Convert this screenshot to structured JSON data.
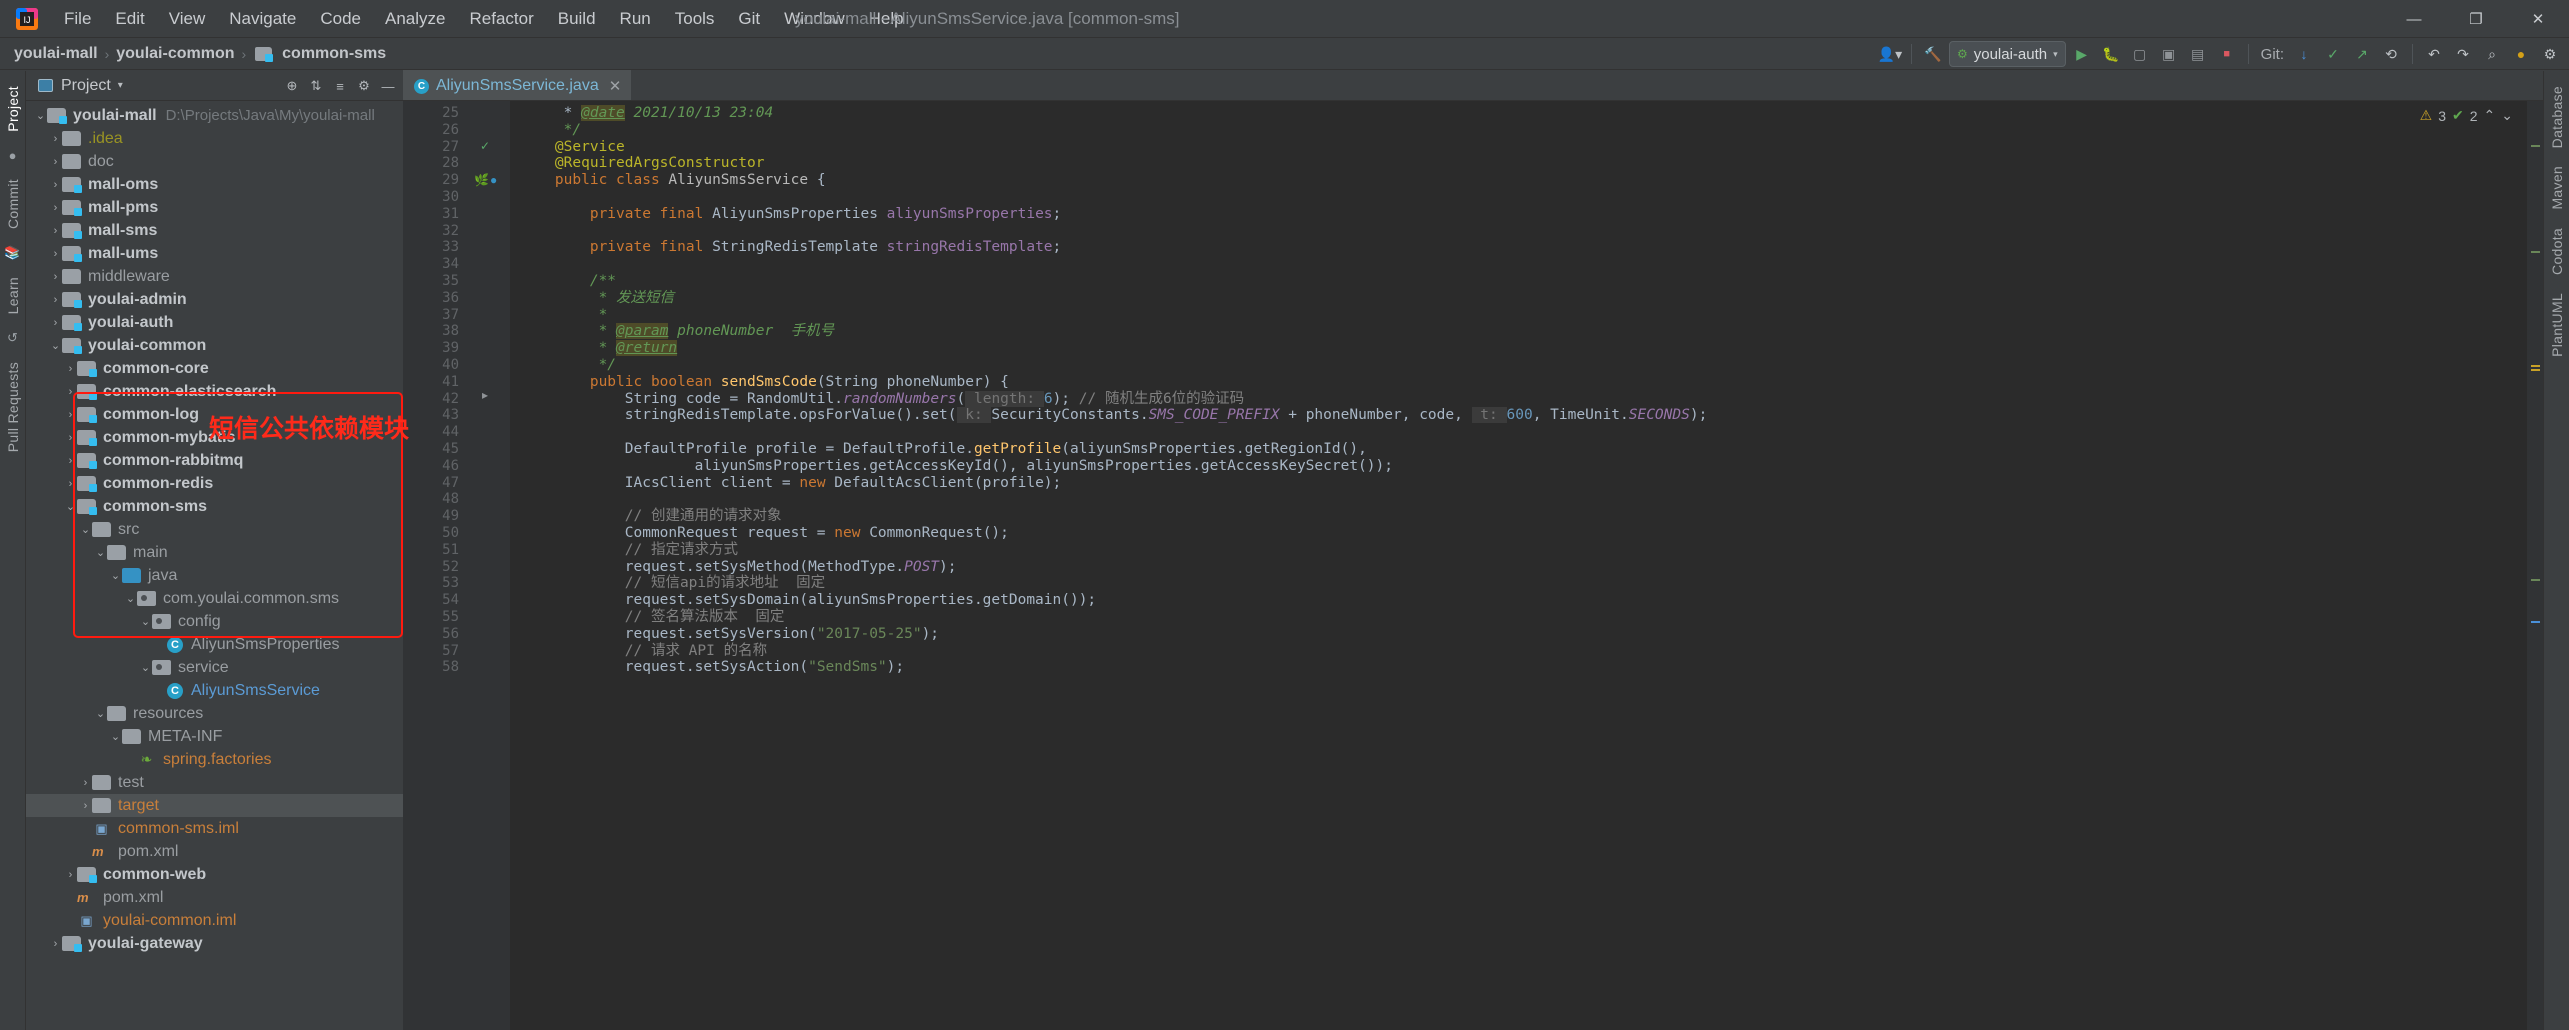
{
  "window": {
    "title": "youlai-mall - AliyunSmsService.java [common-sms]",
    "minimize": "—",
    "maximize": "❐",
    "close": "✕"
  },
  "menu": {
    "items": [
      "File",
      "Edit",
      "View",
      "Navigate",
      "Code",
      "Analyze",
      "Refactor",
      "Build",
      "Run",
      "Tools",
      "Git",
      "Window",
      "Help"
    ]
  },
  "breadcrumb": {
    "items": [
      "youlai-mall",
      "youlai-common",
      "common-sms"
    ],
    "separator": "›"
  },
  "toolbar": {
    "account_icon": "account-icon",
    "hammer_icon": "build-icon",
    "run_config": "youlai-auth",
    "run_icon": "▶",
    "debug_icon": "debug-icon",
    "coverage_icon": "coverage-icon",
    "profile_icon": "profile-icon",
    "stop_icon": "■",
    "git_label": "Git:",
    "git_update_icon": "↓",
    "git_commit_icon": "✓",
    "git_push_icon": "↗",
    "git_history_icon": "⟲",
    "undo_icon": "↶",
    "redo_icon": "↷",
    "search_icon": "⌕",
    "settings_icon": "⚙",
    "notification_icon": "notification-icon"
  },
  "left_rail": {
    "tabs": [
      "Project",
      "Commit",
      "Learn",
      "Pull Requests"
    ]
  },
  "right_rail": {
    "tabs": [
      "Database",
      "Maven",
      "Codota",
      "PlantUML"
    ]
  },
  "project_panel": {
    "title": "Project",
    "caret": "▾",
    "tools": [
      "⊕",
      "⇅",
      "≡",
      "⚙",
      "—"
    ]
  },
  "tree": [
    {
      "indent": 0,
      "arrow": "⌄",
      "icon": "folder-module",
      "label": "youlai-mall",
      "style": "mod",
      "path": "D:\\Projects\\Java\\My\\youlai-mall"
    },
    {
      "indent": 1,
      "arrow": "›",
      "icon": "folder",
      "label": ".idea",
      "style": "yellow"
    },
    {
      "indent": 1,
      "arrow": "›",
      "icon": "folder",
      "label": "doc",
      "style": "dim"
    },
    {
      "indent": 1,
      "arrow": "›",
      "icon": "folder-module",
      "label": "mall-oms",
      "style": "mod"
    },
    {
      "indent": 1,
      "arrow": "›",
      "icon": "folder-module",
      "label": "mall-pms",
      "style": "mod"
    },
    {
      "indent": 1,
      "arrow": "›",
      "icon": "folder-module",
      "label": "mall-sms",
      "style": "mod"
    },
    {
      "indent": 1,
      "arrow": "›",
      "icon": "folder-module",
      "label": "mall-ums",
      "style": "mod"
    },
    {
      "indent": 1,
      "arrow": "›",
      "icon": "folder",
      "label": "middleware",
      "style": "dim"
    },
    {
      "indent": 1,
      "arrow": "›",
      "icon": "folder-module",
      "label": "youlai-admin",
      "style": "mod"
    },
    {
      "indent": 1,
      "arrow": "›",
      "icon": "folder-module",
      "label": "youlai-auth",
      "style": "mod"
    },
    {
      "indent": 1,
      "arrow": "⌄",
      "icon": "folder-module",
      "label": "youlai-common",
      "style": "mod"
    },
    {
      "indent": 2,
      "arrow": "›",
      "icon": "folder-module",
      "label": "common-core",
      "style": "mod"
    },
    {
      "indent": 2,
      "arrow": "›",
      "icon": "folder-module",
      "label": "common-elasticsearch",
      "style": "mod"
    },
    {
      "indent": 2,
      "arrow": "›",
      "icon": "folder-module",
      "label": "common-log",
      "style": "mod"
    },
    {
      "indent": 2,
      "arrow": "›",
      "icon": "folder-module",
      "label": "common-mybatis",
      "style": "mod"
    },
    {
      "indent": 2,
      "arrow": "›",
      "icon": "folder-module",
      "label": "common-rabbitmq",
      "style": "mod"
    },
    {
      "indent": 2,
      "arrow": "›",
      "icon": "folder-module",
      "label": "common-redis",
      "style": "mod"
    },
    {
      "indent": 2,
      "arrow": "⌄",
      "icon": "folder-module",
      "label": "common-sms",
      "style": "mod"
    },
    {
      "indent": 3,
      "arrow": "⌄",
      "icon": "folder",
      "label": "src",
      "style": "dim"
    },
    {
      "indent": 4,
      "arrow": "⌄",
      "icon": "folder",
      "label": "main",
      "style": "dim"
    },
    {
      "indent": 5,
      "arrow": "⌄",
      "icon": "folder-src",
      "label": "java",
      "style": "dim"
    },
    {
      "indent": 6,
      "arrow": "⌄",
      "icon": "package",
      "label": "com.youlai.common.sms",
      "style": "dim"
    },
    {
      "indent": 7,
      "arrow": "⌄",
      "icon": "package",
      "label": "config",
      "style": "dim"
    },
    {
      "indent": 8,
      "arrow": "",
      "icon": "class",
      "label": "AliyunSmsProperties",
      "style": "dim"
    },
    {
      "indent": 7,
      "arrow": "⌄",
      "icon": "package",
      "label": "service",
      "style": "dim"
    },
    {
      "indent": 8,
      "arrow": "",
      "icon": "class",
      "label": "AliyunSmsService",
      "style": "blue"
    },
    {
      "indent": 4,
      "arrow": "⌄",
      "icon": "folder",
      "label": "resources",
      "style": "dim"
    },
    {
      "indent": 5,
      "arrow": "⌄",
      "icon": "folder",
      "label": "META-INF",
      "style": "dim"
    },
    {
      "indent": 6,
      "arrow": "",
      "icon": "leaf",
      "label": "spring.factories",
      "style": "orange"
    },
    {
      "indent": 3,
      "arrow": "›",
      "icon": "folder",
      "label": "test",
      "style": "dim"
    },
    {
      "indent": 3,
      "arrow": "›",
      "icon": "folder",
      "label": "target",
      "style": "orange",
      "selected": true
    },
    {
      "indent": 3,
      "arrow": "",
      "icon": "iml",
      "label": "common-sms.iml",
      "style": "orange"
    },
    {
      "indent": 3,
      "arrow": "",
      "icon": "xml",
      "label": "pom.xml",
      "style": "dim"
    },
    {
      "indent": 2,
      "arrow": "›",
      "icon": "folder-module",
      "label": "common-web",
      "style": "mod"
    },
    {
      "indent": 2,
      "arrow": "",
      "icon": "xml",
      "label": "pom.xml",
      "style": "dim"
    },
    {
      "indent": 2,
      "arrow": "",
      "icon": "iml",
      "label": "youlai-common.iml",
      "style": "orange"
    },
    {
      "indent": 1,
      "arrow": "›",
      "icon": "folder-module",
      "label": "youlai-gateway",
      "style": "mod"
    }
  ],
  "annotation": {
    "text": "短信公共依赖模块",
    "color": "#ff2a1a"
  },
  "editor": {
    "tab": {
      "label": "AliyunSmsService.java",
      "icon": "class-icon",
      "close": "✕"
    },
    "first_line_number": 25,
    "inspection": {
      "warnings": "3",
      "warning_icon": "⚠",
      "oks": "2",
      "ok_icon": "✔",
      "up": "⌃",
      "down": "⌄"
    },
    "lines": [
      {
        "n": 25,
        "html": "     * <span class='doctag'>@date</span> <span class='cmt'>2021/10/13 23:04</span>"
      },
      {
        "n": 26,
        "html": "     <span class='cmt'>*/</span>"
      },
      {
        "n": 27,
        "html": "    <span class='ann'>@Service</span>"
      },
      {
        "n": 28,
        "html": "    <span class='ann'>@RequiredArgsConstructor</span>"
      },
      {
        "n": 29,
        "html": "    <span class='kw'>public class </span><span class='sf'>AliyunSmsService</span> {"
      },
      {
        "n": 30,
        "html": ""
      },
      {
        "n": 31,
        "html": "        <span class='kw'>private final </span>AliyunSmsProperties <span class='fld'>aliyunSmsProperties</span>;"
      },
      {
        "n": 32,
        "html": ""
      },
      {
        "n": 33,
        "html": "        <span class='kw'>private final </span>StringRedisTemplate <span class='fld'>stringRedisTemplate</span>;"
      },
      {
        "n": 34,
        "html": ""
      },
      {
        "n": 35,
        "html": "        <span class='cmt'>/**</span>"
      },
      {
        "n": 36,
        "html": "         <span class='cmt'>* 发送短信</span>"
      },
      {
        "n": 37,
        "html": "         <span class='cmt'>*</span>"
      },
      {
        "n": 38,
        "html": "         <span class='cmt'>* </span><span class='doctag'>@param</span><span class='cmt'> phoneNumber  手机号</span>"
      },
      {
        "n": 39,
        "html": "         <span class='cmt'>* </span><span class='doctag'>@return</span>"
      },
      {
        "n": 40,
        "html": "         <span class='cmt'>*/</span>"
      },
      {
        "n": 41,
        "html": "        <span class='kw'>public boolean </span><span class='mth'>sendSmsCode</span>(String phoneNumber) {"
      },
      {
        "n": 42,
        "html": "            String code = RandomUtil.<span class='cst'>randomNumbers</span>(<span class='hint'> length: </span><span class='num'>6</span>); <span class='cmt2'>// 随机生成6位的验证码</span>"
      },
      {
        "n": 43,
        "html": "            stringRedisTemplate.opsForValue().set(<span class='hint'> k: </span>SecurityConstants.<span class='cst'>SMS_CODE_PREFIX</span> + phoneNumber, code, <span class='hint'> t: </span><span class='num'>600</span>, TimeUnit.<span class='cst'>SECONDS</span>);"
      },
      {
        "n": 44,
        "html": ""
      },
      {
        "n": 45,
        "html": "            DefaultProfile profile = DefaultProfile.<span class='mth'>getProfile</span>(aliyunSmsProperties.getRegionId(),"
      },
      {
        "n": 46,
        "html": "                    aliyunSmsProperties.getAccessKeyId(), aliyunSmsProperties.getAccessKeySecret());"
      },
      {
        "n": 47,
        "html": "            IAcsClient client = <span class='kw'>new </span>DefaultAcsClient(profile);"
      },
      {
        "n": 48,
        "html": ""
      },
      {
        "n": 49,
        "html": "            <span class='cmt2'>// 创建通用的请求对象</span>"
      },
      {
        "n": 50,
        "html": "            CommonRequest request = <span class='kw'>new </span>CommonRequest();"
      },
      {
        "n": 51,
        "html": "            <span class='cmt2'>// 指定请求方式</span>"
      },
      {
        "n": 52,
        "html": "            request.setSysMethod(MethodType.<span class='cst'>POST</span>);"
      },
      {
        "n": 53,
        "html": "            <span class='cmt2'>// 短信api的请求地址  固定</span>"
      },
      {
        "n": 54,
        "html": "            request.setSysDomain(aliyunSmsProperties.getDomain());"
      },
      {
        "n": 55,
        "html": "            <span class='cmt2'>// 签名算法版本  固定</span>"
      },
      {
        "n": 56,
        "html": "            request.setSysVersion(<span class='str'>\"2017-05-25\"</span>);"
      },
      {
        "n": 57,
        "html": "            <span class='cmt2'>// 请求 API 的名称</span>"
      },
      {
        "n": 58,
        "html": "            request.setSysAction(<span class='str'>\"SendSms\"</span>);"
      }
    ]
  }
}
